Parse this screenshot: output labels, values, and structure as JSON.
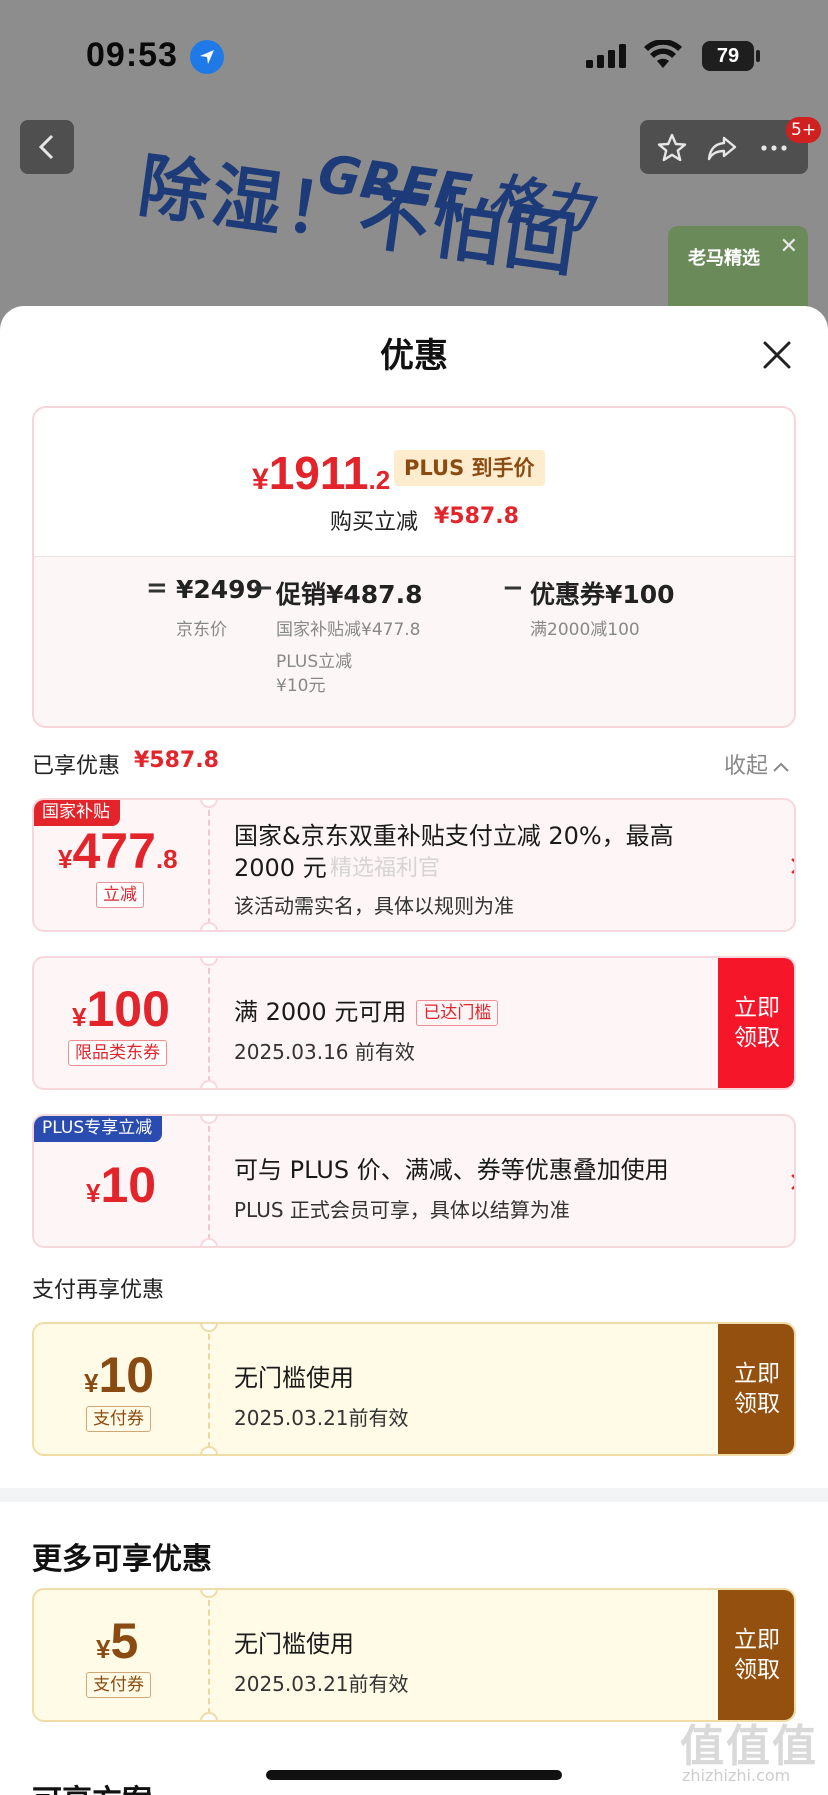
{
  "status_bar": {
    "time": "09:53",
    "battery": "79"
  },
  "product": {
    "banner_text": "除湿！不怕回",
    "brand": "GREE 格力",
    "badge": "5+",
    "promo_title": "老马精选"
  },
  "sheet": {
    "title": "优惠",
    "summary": {
      "currency": "¥",
      "price_int": "1911",
      "price_dec": ".2",
      "plus_tag": "PLUS 到手价",
      "instant_label": "购买立减",
      "instant_value": "¥587.8",
      "eq": "=",
      "minus": "−",
      "jd_price": "¥2499",
      "jd_price_label": "京东价",
      "promo": "促销¥487.8",
      "promo_sub1": "国家补贴减¥477.8",
      "promo_sub2a": "PLUS立减",
      "promo_sub2b": "¥10元",
      "coupon": "优惠券¥100",
      "coupon_sub": "满2000减100"
    },
    "enjoyed_label": "已享优惠",
    "enjoyed_value": "¥587.8",
    "collapse_label": "收起",
    "pay_section_label": "支付再享优惠",
    "more_heading": "更多可享优惠",
    "next_heading": "可享方案",
    "coupons": [
      {
        "corner": "国家补贴",
        "currency": "¥",
        "big": "477",
        "small": ".8",
        "tag": "立减",
        "title1": "国家&京东双重补贴支付立减 20%，最高",
        "title2": "2000 元",
        "sub": "该活动需实名，具体以规则为准"
      },
      {
        "currency": "¥",
        "big": "100",
        "tag": "限品类东券",
        "title": "满 2000 元可用",
        "threshold": "已达门槛",
        "sub": "2025.03.16 前有效",
        "claim1": "立即",
        "claim2": "领取"
      },
      {
        "corner": "PLUS专享立减",
        "currency": "¥",
        "big": "10",
        "title": "可与 PLUS 价、满减、券等优惠叠加使用",
        "sub": "PLUS 正式会员可享，具体以结算为准"
      },
      {
        "currency": "¥",
        "big": "10",
        "tag": "支付券",
        "title": "无门槛使用",
        "sub": "2025.03.21前有效",
        "claim1": "立即",
        "claim2": "领取"
      },
      {
        "currency": "¥",
        "big": "5",
        "tag": "支付券",
        "title": "无门槛使用",
        "sub": "2025.03.21前有效",
        "claim1": "立即",
        "claim2": "领取"
      }
    ]
  },
  "watermark": {
    "center": "精选福利官",
    "logo": "值值值",
    "domain": "zhizhizhi.com"
  },
  "colors": {
    "accent_red": "#e3242b",
    "claim_red": "#f5162a",
    "claim_brown": "#94500e",
    "plus_blue": "#2a4bb0"
  }
}
